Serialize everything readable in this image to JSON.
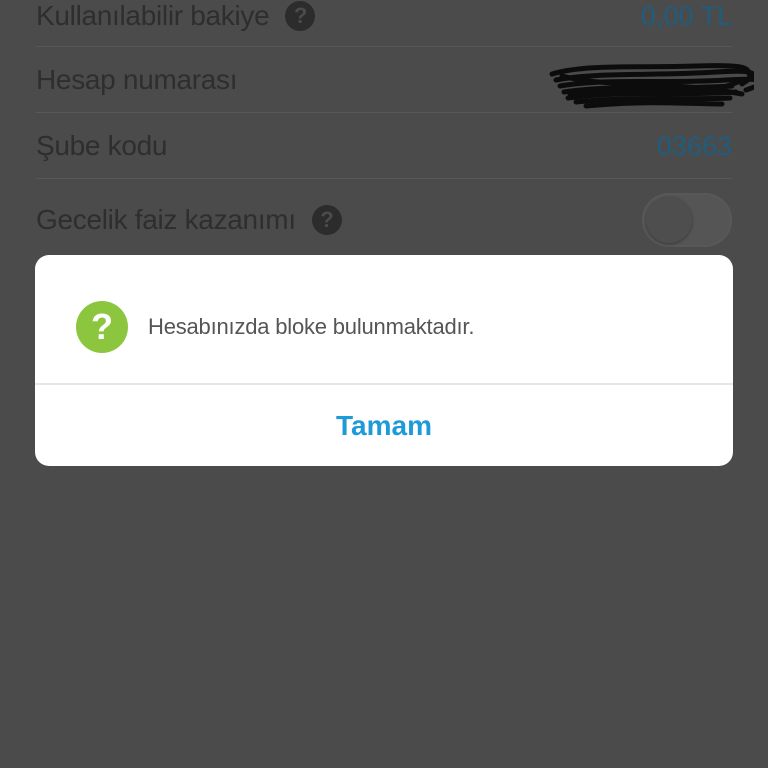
{
  "account_info": {
    "rows": [
      {
        "label": "Kullanılabilir bakiye",
        "value": "0,00 TL"
      },
      {
        "label": "Hesap numarası",
        "value": ""
      },
      {
        "label": "Şube kodu",
        "value": "03663"
      },
      {
        "label": "Gecelik faiz kazanımı"
      }
    ],
    "help_icon_glyph": "?",
    "overnight_interest_toggle": "off"
  },
  "alert": {
    "icon": "question-circle-icon",
    "icon_glyph": "?",
    "icon_color": "#8cc63f",
    "message": "Hesabınızda bloke bulunmaktadır.",
    "ok_label": "Tamam",
    "ok_color": "#1e9ad8"
  }
}
